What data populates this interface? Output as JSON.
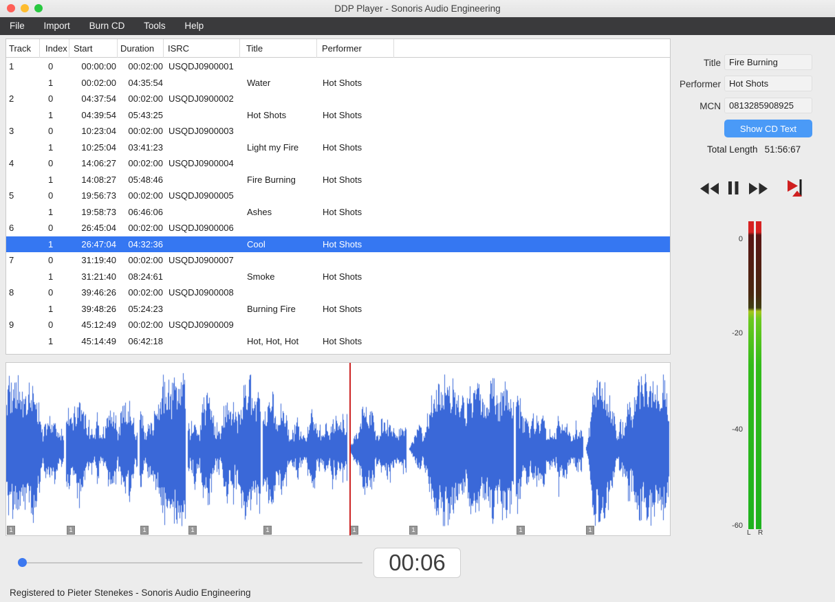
{
  "window": {
    "title": "DDP Player - Sonoris Audio Engineering",
    "menu": [
      "File",
      "Import",
      "Burn CD",
      "Tools",
      "Help"
    ]
  },
  "table": {
    "columns": [
      "Track",
      "Index",
      "Start",
      "Duration",
      "ISRC",
      "Title",
      "Performer"
    ],
    "rows": [
      {
        "track": "1",
        "index": "0",
        "start": "00:00:00",
        "duration": "00:02:00",
        "isrc": "USQDJ0900001",
        "title": "",
        "performer": "",
        "selected": false
      },
      {
        "track": "",
        "index": "1",
        "start": "00:02:00",
        "duration": "04:35:54",
        "isrc": "",
        "title": "Water",
        "performer": "Hot Shots",
        "selected": false
      },
      {
        "track": "2",
        "index": "0",
        "start": "04:37:54",
        "duration": "00:02:00",
        "isrc": "USQDJ0900002",
        "title": "",
        "performer": "",
        "selected": false
      },
      {
        "track": "",
        "index": "1",
        "start": "04:39:54",
        "duration": "05:43:25",
        "isrc": "",
        "title": "Hot Shots",
        "performer": "Hot Shots",
        "selected": false
      },
      {
        "track": "3",
        "index": "0",
        "start": "10:23:04",
        "duration": "00:02:00",
        "isrc": "USQDJ0900003",
        "title": "",
        "performer": "",
        "selected": false
      },
      {
        "track": "",
        "index": "1",
        "start": "10:25:04",
        "duration": "03:41:23",
        "isrc": "",
        "title": "Light my Fire",
        "performer": "Hot Shots",
        "selected": false
      },
      {
        "track": "4",
        "index": "0",
        "start": "14:06:27",
        "duration": "00:02:00",
        "isrc": "USQDJ0900004",
        "title": "",
        "performer": "",
        "selected": false
      },
      {
        "track": "",
        "index": "1",
        "start": "14:08:27",
        "duration": "05:48:46",
        "isrc": "",
        "title": "Fire Burning",
        "performer": "Hot Shots",
        "selected": false
      },
      {
        "track": "5",
        "index": "0",
        "start": "19:56:73",
        "duration": "00:02:00",
        "isrc": "USQDJ0900005",
        "title": "",
        "performer": "",
        "selected": false
      },
      {
        "track": "",
        "index": "1",
        "start": "19:58:73",
        "duration": "06:46:06",
        "isrc": "",
        "title": "Ashes",
        "performer": "Hot Shots",
        "selected": false
      },
      {
        "track": "6",
        "index": "0",
        "start": "26:45:04",
        "duration": "00:02:00",
        "isrc": "USQDJ0900006",
        "title": "",
        "performer": "",
        "selected": false
      },
      {
        "track": "",
        "index": "1",
        "start": "26:47:04",
        "duration": "04:32:36",
        "isrc": "",
        "title": "Cool",
        "performer": "Hot Shots",
        "selected": true
      },
      {
        "track": "7",
        "index": "0",
        "start": "31:19:40",
        "duration": "00:02:00",
        "isrc": "USQDJ0900007",
        "title": "",
        "performer": "",
        "selected": false
      },
      {
        "track": "",
        "index": "1",
        "start": "31:21:40",
        "duration": "08:24:61",
        "isrc": "",
        "title": "Smoke",
        "performer": "Hot Shots",
        "selected": false
      },
      {
        "track": "8",
        "index": "0",
        "start": "39:46:26",
        "duration": "00:02:00",
        "isrc": "USQDJ0900008",
        "title": "",
        "performer": "",
        "selected": false
      },
      {
        "track": "",
        "index": "1",
        "start": "39:48:26",
        "duration": "05:24:23",
        "isrc": "",
        "title": "Burning Fire",
        "performer": "Hot Shots",
        "selected": false
      },
      {
        "track": "9",
        "index": "0",
        "start": "45:12:49",
        "duration": "00:02:00",
        "isrc": "USQDJ0900009",
        "title": "",
        "performer": "",
        "selected": false
      },
      {
        "track": "",
        "index": "1",
        "start": "45:14:49",
        "duration": "06:42:18",
        "isrc": "",
        "title": "Hot, Hot, Hot",
        "performer": "Hot Shots",
        "selected": false
      }
    ]
  },
  "cd_text": {
    "title_label": "Title",
    "title_value": "Fire Burning",
    "performer_label": "Performer",
    "performer_value": "Hot Shots",
    "mcn_label": "MCN",
    "mcn_value": "0813285908925",
    "show_button": "Show CD Text",
    "total_length_label": "Total Length",
    "total_length_value": "51:56:67"
  },
  "transport": {
    "time_display": "00:06"
  },
  "meter": {
    "scale": [
      "0",
      "-20",
      "-40",
      "-60"
    ],
    "channels": "L R"
  },
  "waveform": {
    "index_marker": "1",
    "playhead_track": 6
  },
  "footer": "Registered to Pieter Stenekes - Sonoris Audio Engineering",
  "colors": {
    "selection": "#3577f2",
    "accent_button": "#4a9af7",
    "waveform": "#3a68d8",
    "playhead": "#cc2222",
    "meter_green": "#1eb21e",
    "meter_red": "#d62222"
  }
}
